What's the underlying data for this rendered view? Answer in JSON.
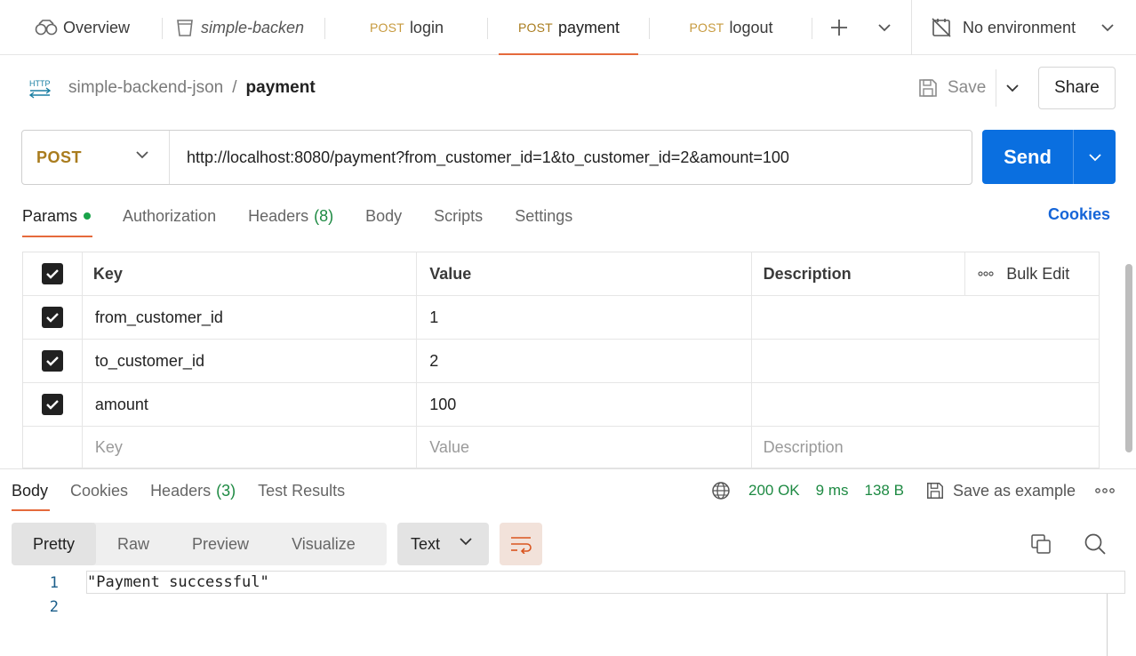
{
  "tabs": [
    {
      "label": "Overview",
      "icon": "overview-icon"
    },
    {
      "label": "simple-backen",
      "icon": "collection-icon"
    },
    {
      "method": "POST",
      "label": "login"
    },
    {
      "method": "POST",
      "label": "payment"
    },
    {
      "method": "POST",
      "label": "logout"
    }
  ],
  "environment": {
    "label": "No environment"
  },
  "breadcrumb": {
    "collection": "simple-backend-json",
    "separator": "/",
    "request": "payment"
  },
  "toolbar": {
    "save_label": "Save",
    "share_label": "Share"
  },
  "request": {
    "method": "POST",
    "url": "http://localhost:8080/payment?from_customer_id=1&to_customer_id=2&amount=100",
    "send_label": "Send"
  },
  "request_tabs": {
    "params": "Params",
    "authorization": "Authorization",
    "headers": "Headers",
    "headers_count": "(8)",
    "body": "Body",
    "scripts": "Scripts",
    "settings": "Settings",
    "cookies": "Cookies"
  },
  "params_table": {
    "headers": {
      "key": "Key",
      "value": "Value",
      "description": "Description",
      "bulk_edit": "Bulk Edit"
    },
    "rows": [
      {
        "key": "from_customer_id",
        "value": "1",
        "description": ""
      },
      {
        "key": "to_customer_id",
        "value": "2",
        "description": ""
      },
      {
        "key": "amount",
        "value": "100",
        "description": ""
      }
    ],
    "placeholders": {
      "key": "Key",
      "value": "Value",
      "description": "Description"
    }
  },
  "response": {
    "tabs": {
      "body": "Body",
      "cookies": "Cookies",
      "headers": "Headers",
      "headers_count": "(3)",
      "test_results": "Test Results"
    },
    "status": "200 OK",
    "time": "9 ms",
    "size": "138 B",
    "save_example": "Save as example",
    "formats": [
      "Pretty",
      "Raw",
      "Preview",
      "Visualize"
    ],
    "type": "Text",
    "lines": [
      {
        "num": "1",
        "text": "\"Payment successful\""
      },
      {
        "num": "2",
        "text": ""
      }
    ]
  },
  "colors": {
    "accent": "#e56a3c",
    "primary": "#0a6fe0",
    "success": "#1e8a43",
    "method": "#a97c1e"
  }
}
